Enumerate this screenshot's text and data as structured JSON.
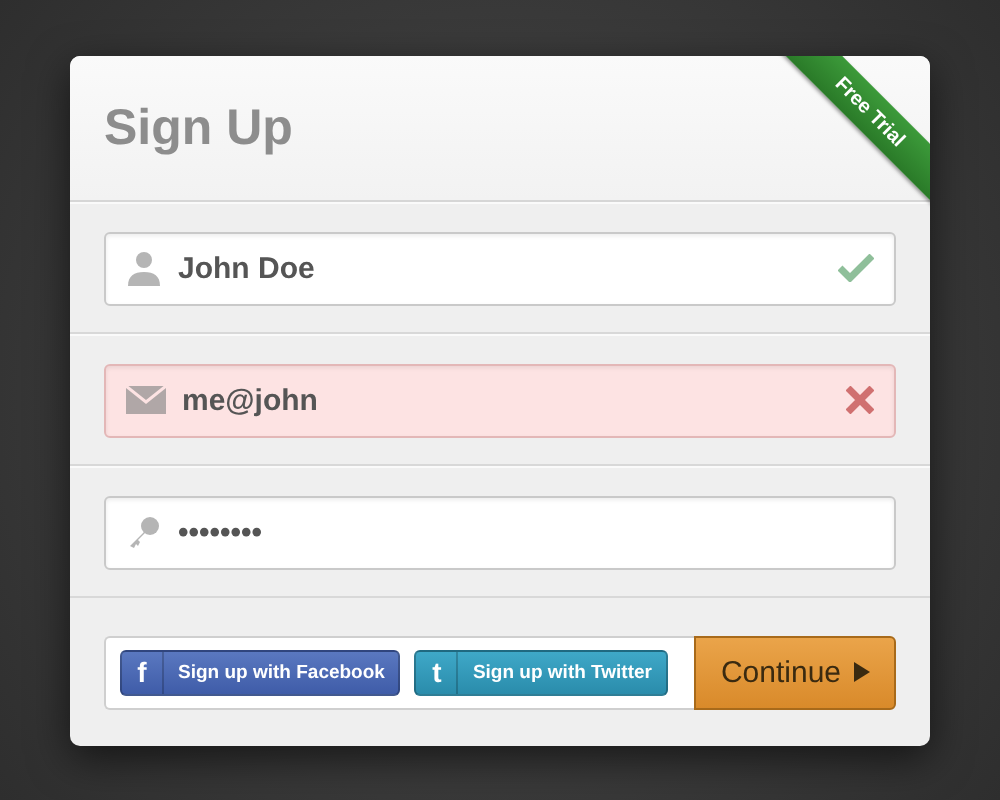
{
  "title": "Sign Up",
  "ribbon": "Free Trial",
  "fields": [
    {
      "kind": "name",
      "value": "John Doe",
      "valid": true,
      "error": false
    },
    {
      "kind": "email",
      "value": "me@john",
      "valid": false,
      "error": true
    },
    {
      "kind": "password",
      "value": "••••••••",
      "valid": false,
      "error": false
    }
  ],
  "social": [
    {
      "kind": "facebook",
      "logo": "f",
      "label": "Sign up with Facebook"
    },
    {
      "kind": "twitter",
      "logo": "t",
      "label": "Sign up with Twitter"
    }
  ],
  "submit": "Continue"
}
